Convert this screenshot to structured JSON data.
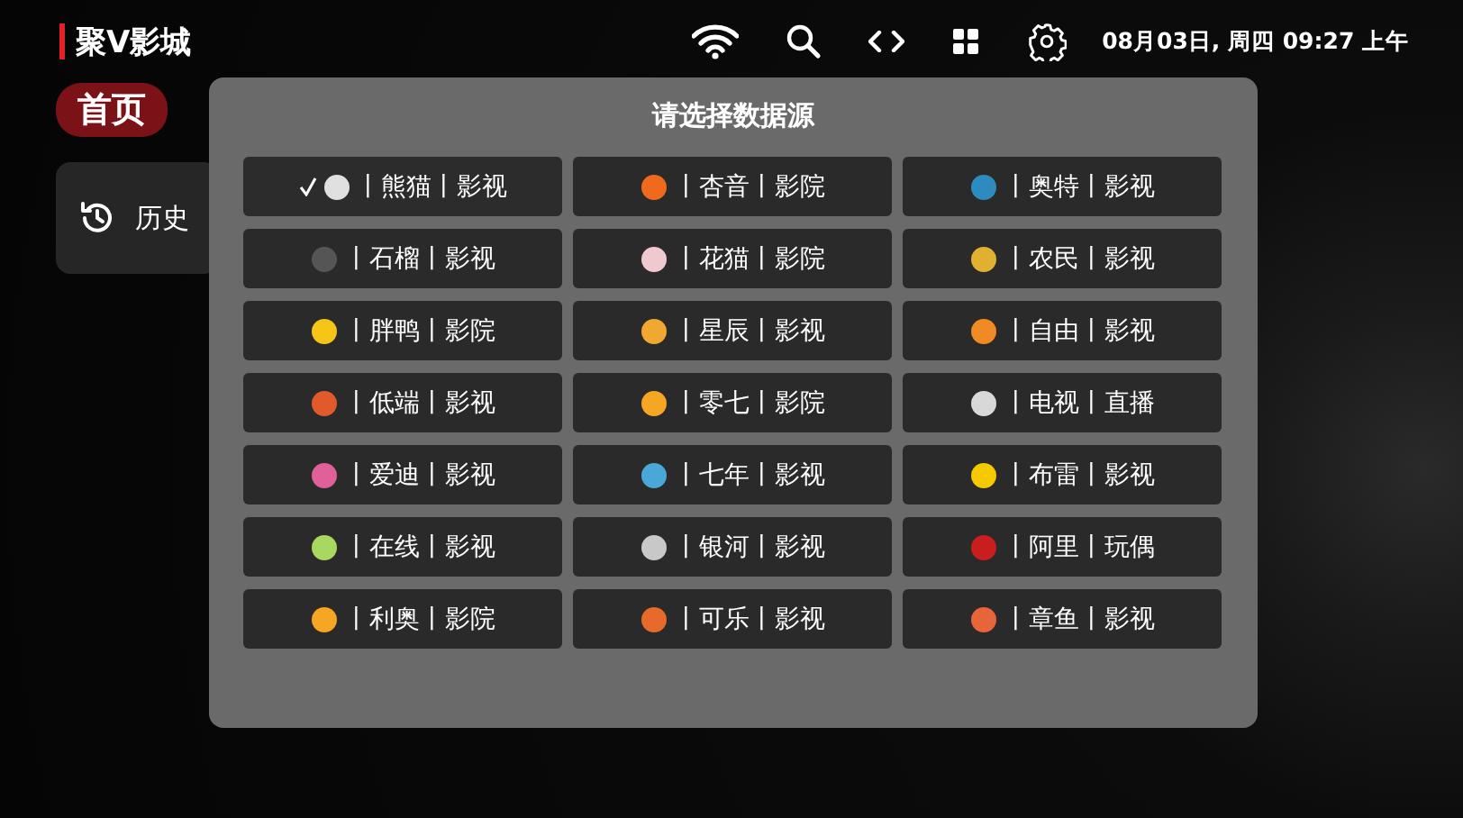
{
  "header": {
    "title": "聚V影城",
    "datetime": "08月03日, 周四 09:27 上午"
  },
  "nav": {
    "home_tab": {
      "label": "首页",
      "selected": true
    }
  },
  "sidebar": {
    "items": [
      {
        "label": "历史"
      }
    ]
  },
  "dialog": {
    "title": "请选择数据源",
    "sources": [
      {
        "label": "丨熊猫丨影视",
        "color": "#e0e0e0",
        "selected": true
      },
      {
        "label": "丨杏音丨影院",
        "color": "#f06a1e",
        "selected": false
      },
      {
        "label": "丨奥特丨影视",
        "color": "#2e8bc0",
        "selected": false
      },
      {
        "label": "丨石榴丨影视",
        "color": "#555555",
        "selected": false
      },
      {
        "label": "丨花猫丨影院",
        "color": "#f2c8d0",
        "selected": false
      },
      {
        "label": "丨农民丨影视",
        "color": "#e0b030",
        "selected": false
      },
      {
        "label": "丨胖鸭丨影院",
        "color": "#f5c518",
        "selected": false
      },
      {
        "label": "丨星辰丨影视",
        "color": "#f0a830",
        "selected": false
      },
      {
        "label": "丨自由丨影视",
        "color": "#f08a24",
        "selected": false
      },
      {
        "label": "丨低端丨影视",
        "color": "#e05a2a",
        "selected": false
      },
      {
        "label": "丨零七丨影院",
        "color": "#f5a623",
        "selected": false
      },
      {
        "label": "丨电视丨直播",
        "color": "#d8d8d8",
        "selected": false
      },
      {
        "label": "丨爱迪丨影视",
        "color": "#e0609a",
        "selected": false
      },
      {
        "label": "丨七年丨影视",
        "color": "#4aa8d8",
        "selected": false
      },
      {
        "label": "丨布雷丨影视",
        "color": "#f5c800",
        "selected": false
      },
      {
        "label": "丨在线丨影视",
        "color": "#a8d860",
        "selected": false
      },
      {
        "label": "丨银河丨影视",
        "color": "#c8c8c8",
        "selected": false
      },
      {
        "label": "丨阿里丨玩偶",
        "color": "#c81e1e",
        "selected": false
      },
      {
        "label": "丨利奥丨影院",
        "color": "#f5a623",
        "selected": false
      },
      {
        "label": "丨可乐丨影视",
        "color": "#e86a2a",
        "selected": false
      },
      {
        "label": "丨章鱼丨影视",
        "color": "#e8643a",
        "selected": false
      }
    ]
  }
}
